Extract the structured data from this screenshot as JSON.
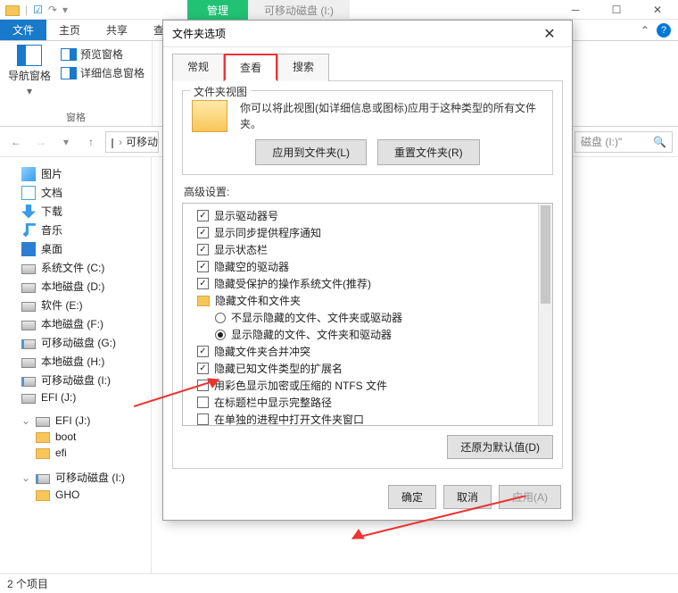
{
  "context": {
    "manage": "管理",
    "drive": "可移动磁盘 (I:)"
  },
  "quick_access": {
    "chk": "☑",
    "redo": "↷"
  },
  "ribbon_tabs": {
    "file": "文件",
    "home": "主页",
    "share": "共享",
    "view_partial": "查"
  },
  "ribbon": {
    "nav_pane": "导航窗格",
    "preview_pane": "预览窗格",
    "details_pane": "详细信息窗格",
    "group_panes": "窗格"
  },
  "navbar": {
    "address": "可移动…",
    "drive_hint": "磁盘 (I:)\""
  },
  "tree": [
    {
      "icon": "img",
      "label": "图片"
    },
    {
      "icon": "doc",
      "label": "文档"
    },
    {
      "icon": "dl",
      "label": "下载"
    },
    {
      "icon": "music",
      "label": "音乐"
    },
    {
      "icon": "desk",
      "label": "桌面"
    },
    {
      "icon": "drive",
      "label": "系统文件 (C:)"
    },
    {
      "icon": "drive",
      "label": "本地磁盘 (D:)"
    },
    {
      "icon": "drive",
      "label": "软件 (E:)"
    },
    {
      "icon": "drive",
      "label": "本地磁盘 (F:)"
    },
    {
      "icon": "usb",
      "label": "可移动磁盘 (G:)"
    },
    {
      "icon": "drive",
      "label": "本地磁盘 (H:)"
    },
    {
      "icon": "usb",
      "label": "可移动磁盘 (I:)"
    },
    {
      "icon": "drive",
      "label": "EFI (J:)"
    }
  ],
  "tree2_header": "EFI (J:)",
  "tree2": [
    {
      "icon": "fold",
      "label": "boot"
    },
    {
      "icon": "fold",
      "label": "efi"
    }
  ],
  "tree3_header": "可移动磁盘 (I:)",
  "tree3": [
    {
      "icon": "fold",
      "label": "GHO"
    }
  ],
  "status": "2 个项目",
  "dialog": {
    "title": "文件夹选项",
    "tabs": {
      "general": "常规",
      "view": "查看",
      "search": "搜索"
    },
    "folder_views": {
      "legend": "文件夹视图",
      "text": "你可以将此视图(如详细信息或图标)应用于这种类型的所有文件夹。",
      "apply": "应用到文件夹(L)",
      "reset": "重置文件夹(R)"
    },
    "advanced_label": "高级设置:",
    "advanced": [
      {
        "type": "cb",
        "checked": true,
        "label": "显示驱动器号"
      },
      {
        "type": "cb",
        "checked": true,
        "label": "显示同步提供程序通知"
      },
      {
        "type": "cb",
        "checked": true,
        "label": "显示状态栏"
      },
      {
        "type": "cb",
        "checked": true,
        "label": "隐藏空的驱动器"
      },
      {
        "type": "cb",
        "checked": true,
        "label": "隐藏受保护的操作系统文件(推荐)"
      },
      {
        "type": "hdr",
        "label": "隐藏文件和文件夹"
      },
      {
        "type": "rb",
        "checked": false,
        "label": "不显示隐藏的文件、文件夹或驱动器"
      },
      {
        "type": "rb",
        "checked": true,
        "label": "显示隐藏的文件、文件夹和驱动器"
      },
      {
        "type": "cb",
        "checked": true,
        "label": "隐藏文件夹合并冲突"
      },
      {
        "type": "cb",
        "checked": true,
        "label": "隐藏已知文件类型的扩展名"
      },
      {
        "type": "cb",
        "checked": false,
        "label": "用彩色显示加密或压缩的 NTFS 文件"
      },
      {
        "type": "cb",
        "checked": false,
        "label": "在标题栏中显示完整路径"
      },
      {
        "type": "cb",
        "checked": false,
        "label": "在单独的进程中打开文件夹窗口"
      }
    ],
    "restore": "还原为默认值(D)",
    "ok": "确定",
    "cancel": "取消",
    "apply_btn": "应用(A)"
  }
}
